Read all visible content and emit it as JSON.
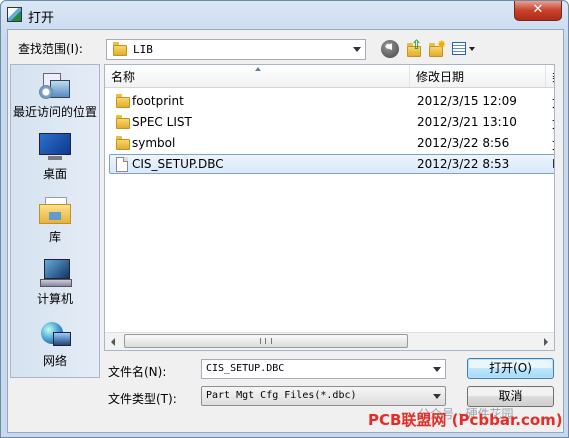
{
  "window": {
    "title": "打开",
    "close_label": "✕"
  },
  "lookin": {
    "label": "查找范围(I):",
    "value": "LIB"
  },
  "places": [
    {
      "label": "最近访问的位置",
      "icon": "recent-places-icon"
    },
    {
      "label": "桌面",
      "icon": "desktop-icon"
    },
    {
      "label": "库",
      "icon": "libraries-icon"
    },
    {
      "label": "计算机",
      "icon": "computer-icon"
    },
    {
      "label": "网络",
      "icon": "network-icon"
    }
  ],
  "columns": {
    "name": "名称",
    "date": "修改日期",
    "type": "类"
  },
  "files": [
    {
      "name": "footprint",
      "date": "2012/3/15 12:09",
      "type": "文",
      "kind": "folder"
    },
    {
      "name": "SPEC LIST",
      "date": "2012/3/21 13:10",
      "type": "文",
      "kind": "folder"
    },
    {
      "name": "symbol",
      "date": "2012/3/22 8:56",
      "type": "文",
      "kind": "folder"
    },
    {
      "name": "CIS_SETUP.DBC",
      "date": "2012/3/22 8:53",
      "type": "D",
      "kind": "file",
      "selected": true
    }
  ],
  "filename": {
    "label": "文件名(N):",
    "value": "CIS_SETUP.DBC"
  },
  "filetype": {
    "label": "文件类型(T):",
    "value": "Part Mgt Cfg Files(*.dbc)"
  },
  "buttons": {
    "open": "打开(O)",
    "cancel": "取消"
  },
  "watermark": {
    "text": "PCB联盟网 (Pcbbar.com)",
    "sub": "公众号 · 硬件花园"
  }
}
